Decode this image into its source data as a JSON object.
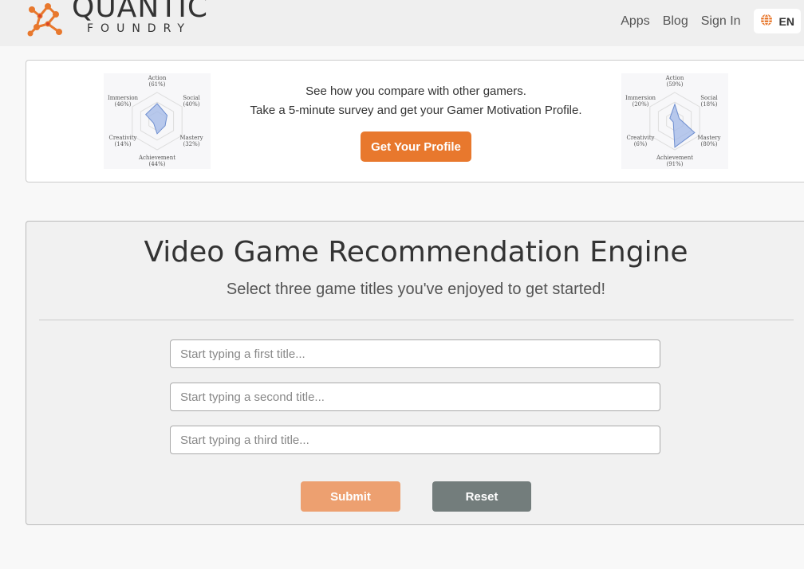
{
  "header": {
    "logo_word": "QUANTIC",
    "logo_sub": "FOUNDRY",
    "nav": {
      "apps": "Apps",
      "blog": "Blog",
      "sign_in": "Sign In"
    },
    "language": "EN",
    "brand_color": "#e8782d"
  },
  "promo": {
    "line1": "See how you compare with other gamers.",
    "line2": "Take a 5-minute survey and get your Gamer Motivation Profile.",
    "button": "Get Your Profile",
    "profiles": [
      {
        "action": "Action",
        "action_pct": "(61%)",
        "social": "Social",
        "social_pct": "(40%)",
        "mastery": "Mastery",
        "mastery_pct": "(32%)",
        "achievement": "Achievement",
        "achievement_pct": "(44%)",
        "creativity": "Creativity",
        "creativity_pct": "(14%)",
        "immersion": "Immersion",
        "immersion_pct": "(46%)",
        "values": [
          0.61,
          0.4,
          0.32,
          0.44,
          0.14,
          0.46
        ]
      },
      {
        "action": "Action",
        "action_pct": "(59%)",
        "social": "Social",
        "social_pct": "(18%)",
        "mastery": "Mastery",
        "mastery_pct": "(80%)",
        "achievement": "Achievement",
        "achievement_pct": "(91%)",
        "creativity": "Creativity",
        "creativity_pct": "(6%)",
        "immersion": "Immersion",
        "immersion_pct": "(20%)",
        "values": [
          0.59,
          0.18,
          0.8,
          0.91,
          0.06,
          0.2
        ]
      }
    ]
  },
  "engine": {
    "title": "Video Game Recommendation Engine",
    "subtitle": "Select three game titles you've enjoyed to get started!",
    "inputs": [
      {
        "placeholder": "Start typing a first title...",
        "value": ""
      },
      {
        "placeholder": "Start typing a second title...",
        "value": ""
      },
      {
        "placeholder": "Start typing a third title...",
        "value": ""
      }
    ],
    "submit": "Submit",
    "reset": "Reset"
  }
}
